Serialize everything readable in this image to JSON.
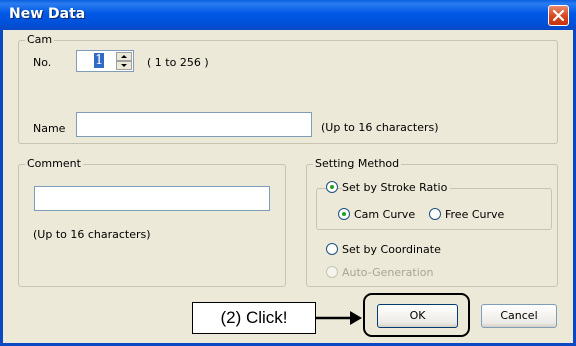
{
  "window": {
    "title": "New Data"
  },
  "cam": {
    "legend": "Cam",
    "no_label": "No.",
    "no_value": "1",
    "range_hint": "( 1 to 256 )",
    "name_label": "Name",
    "name_value": "",
    "name_hint": "(Up to 16 characters)"
  },
  "comment": {
    "legend": "Comment",
    "value": "",
    "hint": "(Up to 16 characters)"
  },
  "setting_method": {
    "legend": "Setting Method",
    "options": [
      {
        "label": "Set by Stroke Ratio",
        "checked": true,
        "disabled": false
      },
      {
        "label": "Set by Coordinate",
        "checked": false,
        "disabled": false
      },
      {
        "label": "Auto-Generation",
        "checked": false,
        "disabled": true
      }
    ],
    "sub_options": [
      {
        "label": "Cam Curve",
        "checked": true
      },
      {
        "label": "Free Curve",
        "checked": false
      }
    ]
  },
  "buttons": {
    "ok": "OK",
    "cancel": "Cancel"
  },
  "annotation": {
    "callout": "(2) Click!"
  },
  "colors": {
    "titlebar": "#0058e6",
    "dialog_bg": "#ece9d8",
    "close_button": "#d8451d"
  }
}
